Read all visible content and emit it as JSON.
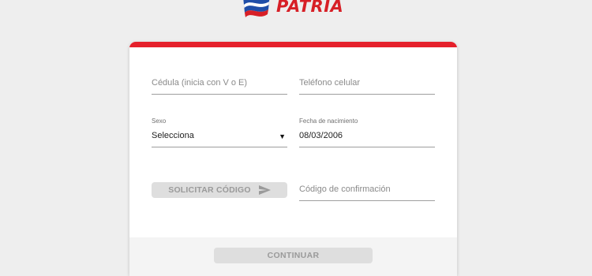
{
  "brand": {
    "name": "PATRIA",
    "flag_colors": [
      "#1f4ea8",
      "#d71f26"
    ]
  },
  "form": {
    "cedula_placeholder": "Cédula (inicia con V o E)",
    "telefono_placeholder": "Teléfono celular",
    "sexo_label": "Sexo",
    "sexo_value": "Selecciona",
    "fecha_label": "Fecha de nacimiento",
    "fecha_value": "08/03/2006",
    "solicitar_label": "SOLICITAR CÓDIGO",
    "codigo_placeholder": "Código de confirmación",
    "continuar_label": "CONTINUAR"
  },
  "colors": {
    "accent": "#e5202b",
    "button_disabled": "#dedede"
  },
  "icons": {
    "solicitar": "send-icon",
    "sexo_caret": "caret-down-icon"
  }
}
